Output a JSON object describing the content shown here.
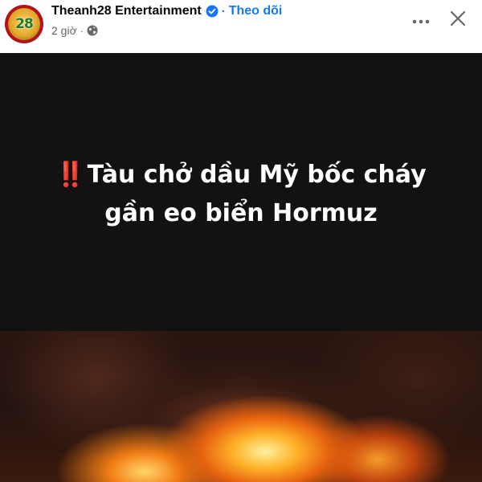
{
  "post": {
    "page_name": "Theanh28 Entertainment",
    "follow_label": "Theo dõi",
    "separator": "·",
    "time_ago": "2 giờ",
    "avatar_text": "28",
    "icons": {
      "verified": "verified-badge-icon",
      "privacy": "globe-icon",
      "more": "more-options-icon",
      "close": "close-icon"
    },
    "colors": {
      "link_blue": "#1877f2",
      "media_background": "#121212",
      "headline_text": "#ffffff",
      "alert_red": "#e02020"
    }
  },
  "media": {
    "alert_mark": "‼️",
    "headline_line1": "Tàu chở dầu Mỹ bốc cháy",
    "headline_line2": "gần eo biển Hormuz",
    "photo": "burning-tanker-photo"
  }
}
